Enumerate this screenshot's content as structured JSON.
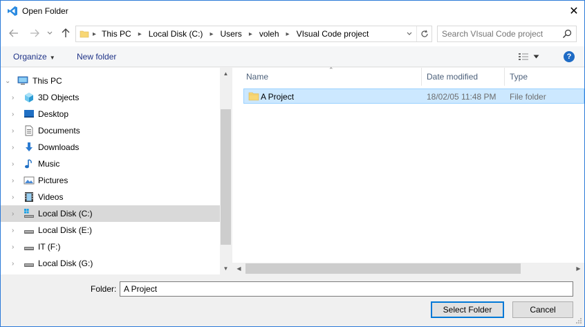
{
  "window": {
    "title": "Open Folder",
    "close_glyph": "✕"
  },
  "address_bar": {
    "breadcrumbs": [
      "This PC",
      "Local Disk (C:)",
      "Users",
      "voleh",
      "VIsual Code project"
    ]
  },
  "search": {
    "placeholder": "Search VIsual Code project"
  },
  "toolbar": {
    "organize_label": "Organize",
    "new_folder_label": "New folder",
    "help_glyph": "?"
  },
  "nav_tree": {
    "items": [
      {
        "label": "This PC",
        "icon": "computer-icon"
      },
      {
        "label": "3D Objects",
        "icon": "3d-objects-icon"
      },
      {
        "label": "Desktop",
        "icon": "desktop-icon"
      },
      {
        "label": "Documents",
        "icon": "documents-icon"
      },
      {
        "label": "Downloads",
        "icon": "downloads-icon"
      },
      {
        "label": "Music",
        "icon": "music-icon"
      },
      {
        "label": "Pictures",
        "icon": "pictures-icon"
      },
      {
        "label": "Videos",
        "icon": "videos-icon"
      },
      {
        "label": "Local Disk (C:)",
        "icon": "system-drive-icon",
        "selected": true
      },
      {
        "label": "Local Disk (E:)",
        "icon": "drive-icon"
      },
      {
        "label": "IT (F:)",
        "icon": "drive-icon"
      },
      {
        "label": "Local Disk (G:)",
        "icon": "drive-icon"
      }
    ]
  },
  "file_list": {
    "columns": [
      "Name",
      "Date modified",
      "Type"
    ],
    "rows": [
      {
        "name": "A Project",
        "date_modified": "18/02/05 11:48 PM",
        "type": "File folder",
        "selected": true
      }
    ]
  },
  "footer": {
    "folder_label": "Folder:",
    "folder_value": "A Project",
    "select_button": "Select Folder",
    "cancel_button": "Cancel"
  },
  "colors": {
    "accent": "#0078d7",
    "selection": "#cce8ff",
    "selection_border": "#99d1ff",
    "folder": "#f8d775"
  }
}
